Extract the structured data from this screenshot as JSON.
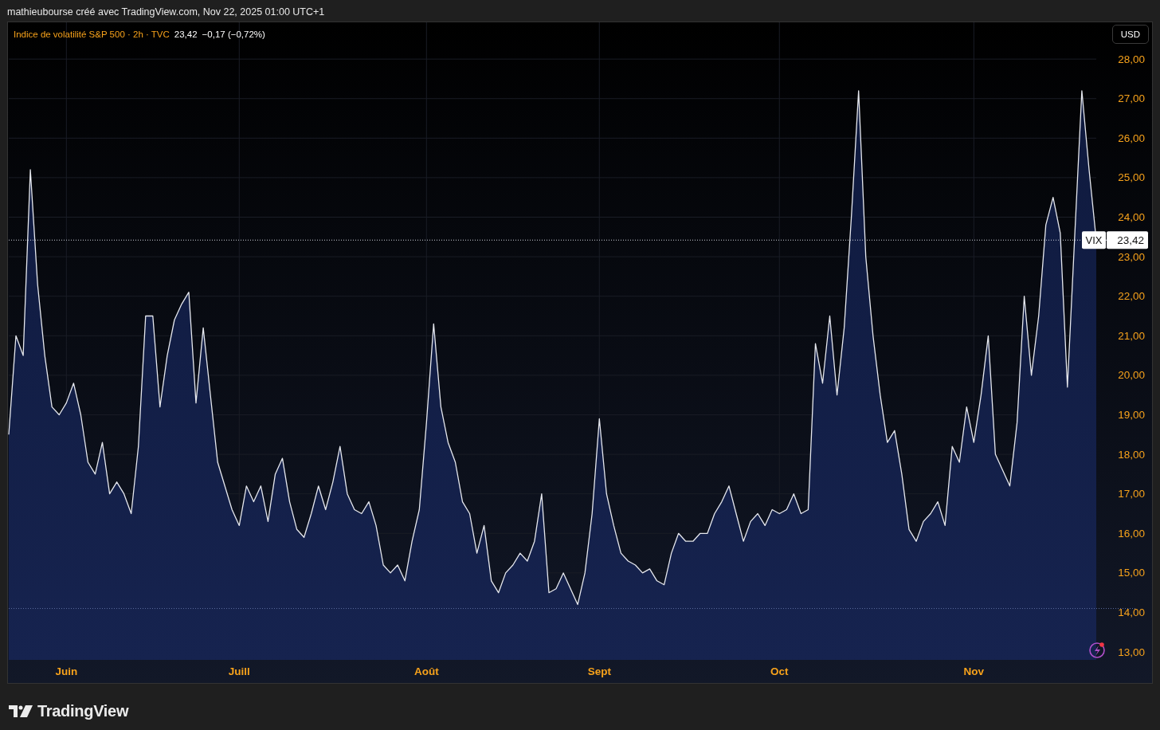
{
  "header": {
    "text": "mathieubourse créé avec TradingView.com, Nov 22, 2025 01:00 UTC+1"
  },
  "chart": {
    "legend": {
      "title": "Indice de volatilité S&P 500 · 2h · TVC",
      "price": "23,42",
      "change": "−0,17 (−0,72%)"
    },
    "currency_button": "USD",
    "chart_data": {
      "type": "area",
      "grid": true,
      "ylim": [
        12.8,
        28.93
      ],
      "categories": [
        null,
        null,
        null,
        null,
        null,
        null,
        null,
        null,
        "Juin",
        null,
        null,
        null,
        null,
        null,
        null,
        null,
        null,
        null,
        null,
        null,
        null,
        null,
        null,
        null,
        null,
        null,
        null,
        null,
        null,
        null,
        null,
        null,
        "Juill",
        null,
        null,
        null,
        null,
        null,
        null,
        null,
        null,
        null,
        null,
        null,
        null,
        null,
        null,
        null,
        null,
        null,
        null,
        null,
        null,
        null,
        null,
        null,
        null,
        null,
        "Août",
        null,
        null,
        null,
        null,
        null,
        null,
        null,
        null,
        null,
        null,
        null,
        null,
        null,
        null,
        null,
        null,
        null,
        null,
        null,
        null,
        null,
        null,
        null,
        "Sept",
        null,
        null,
        null,
        null,
        null,
        null,
        null,
        null,
        null,
        null,
        null,
        null,
        null,
        null,
        null,
        null,
        null,
        null,
        null,
        null,
        null,
        null,
        null,
        null,
        "Oct",
        null,
        null,
        null,
        null,
        null,
        null,
        null,
        null,
        null,
        null,
        null,
        null,
        null,
        null,
        null,
        null,
        null,
        null,
        null,
        null,
        null,
        null,
        null,
        null,
        null,
        null,
        "Nov",
        null,
        null,
        null,
        null,
        null,
        null,
        null,
        null,
        null,
        null,
        null,
        null,
        null,
        null,
        null,
        null,
        null
      ],
      "yticks": [
        {
          "value": 13,
          "label": "13,00"
        },
        {
          "value": 14,
          "label": "14,00"
        },
        {
          "value": 15,
          "label": "15,00"
        },
        {
          "value": 16,
          "label": "16,00"
        },
        {
          "value": 17,
          "label": "17,00"
        },
        {
          "value": 18,
          "label": "18,00"
        },
        {
          "value": 19,
          "label": "19,00"
        },
        {
          "value": 20,
          "label": "20,00"
        },
        {
          "value": 21,
          "label": "21,00"
        },
        {
          "value": 22,
          "label": "22,00"
        },
        {
          "value": 23,
          "label": "23,00"
        },
        {
          "value": 24,
          "label": "24,00"
        },
        {
          "value": 25,
          "label": "25,00"
        },
        {
          "value": 26,
          "label": "26,00"
        },
        {
          "value": 27,
          "label": "27,00"
        },
        {
          "value": 28,
          "label": "28,00"
        }
      ],
      "series": [
        {
          "name": "VIX",
          "color": "#e6e8ee",
          "values": [
            18.5,
            21,
            20.5,
            25.2,
            22.3,
            20.5,
            19.2,
            19,
            19.3,
            19.8,
            19,
            17.8,
            17.5,
            18.3,
            17,
            17.3,
            17,
            16.5,
            18.2,
            21.5,
            21.5,
            19.2,
            20.5,
            21.4,
            21.8,
            22.1,
            19.3,
            21.2,
            19.5,
            17.8,
            17.2,
            16.6,
            16.2,
            17.2,
            16.8,
            17.2,
            16.3,
            17.5,
            17.9,
            16.8,
            16.1,
            15.9,
            16.5,
            17.2,
            16.6,
            17.3,
            18.2,
            17,
            16.6,
            16.5,
            16.8,
            16.2,
            15.2,
            15,
            15.2,
            14.8,
            15.8,
            16.6,
            18.8,
            21.3,
            19.2,
            18.3,
            17.8,
            16.8,
            16.5,
            15.5,
            16.2,
            14.8,
            14.5,
            15,
            15.2,
            15.5,
            15.3,
            15.8,
            17,
            14.5,
            14.6,
            15,
            14.6,
            14.2,
            15,
            16.5,
            18.9,
            17,
            16.2,
            15.5,
            15.3,
            15.2,
            15,
            15.1,
            14.8,
            14.7,
            15.5,
            16,
            15.8,
            15.8,
            16,
            16,
            16.5,
            16.8,
            17.2,
            16.5,
            15.8,
            16.3,
            16.5,
            16.2,
            16.6,
            16.5,
            16.6,
            17,
            16.5,
            16.6,
            20.8,
            19.8,
            21.5,
            19.5,
            21.2,
            24,
            27.2,
            23,
            21,
            19.5,
            18.3,
            18.6,
            17.5,
            16.1,
            15.8,
            16.3,
            16.5,
            16.8,
            16.2,
            18.2,
            17.8,
            19.2,
            18.3,
            19.5,
            21,
            18,
            17.6,
            17.2,
            18.8,
            22,
            20,
            21.5,
            23.8,
            24.5,
            23.6,
            19.7,
            23.5,
            27.2,
            25.2,
            23.42
          ]
        }
      ],
      "ref_lines": [
        {
          "axis": "y",
          "value": 23.42,
          "label": "23,42",
          "color": "#cfd3dc"
        },
        {
          "axis": "y",
          "value": 14.1,
          "color": "#5a6a9c"
        }
      ]
    }
  },
  "footer": {
    "logo_text": "TradingView"
  }
}
